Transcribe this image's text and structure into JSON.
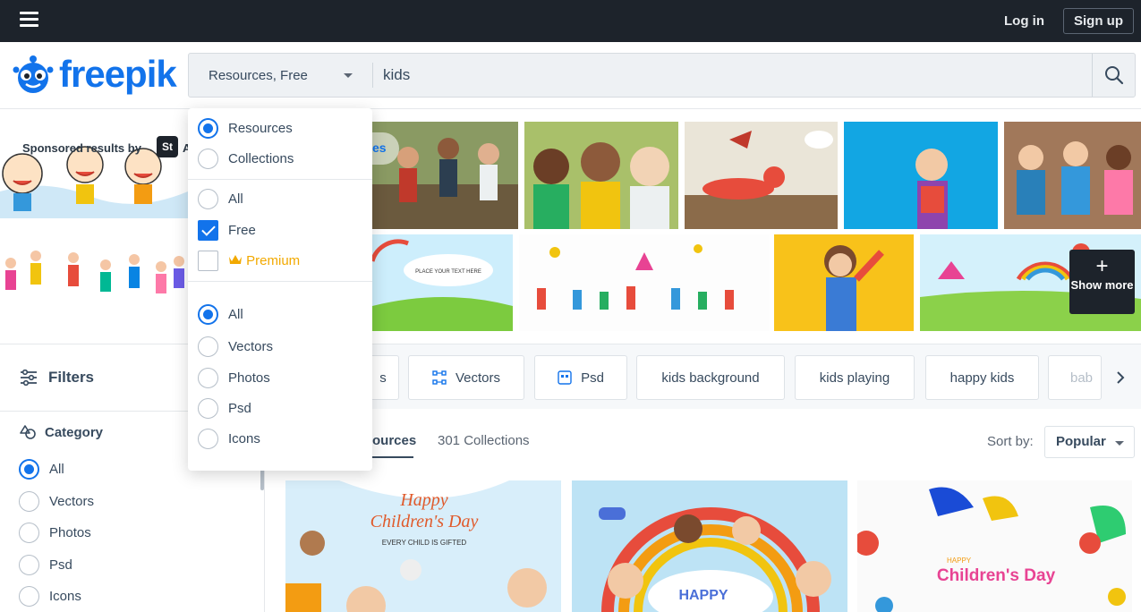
{
  "topbar": {
    "login": "Log in",
    "signup": "Sign up"
  },
  "logo": {
    "text": "freepik"
  },
  "search": {
    "type_label": "Resources, Free",
    "query": "kids"
  },
  "sidebar": {
    "sponsored": "Sponsored results by",
    "st_badge": "St",
    "st_suffix": "A",
    "filters_label": "Filters",
    "category_label": "Category",
    "category_options": [
      "All",
      "Vectors",
      "Photos",
      "Psd",
      "Icons"
    ]
  },
  "grid": {
    "show_more": "Show more",
    "overlay_text": "es"
  },
  "tags": [
    "s",
    "Vectors",
    "Psd",
    "kids background",
    "kids playing",
    "happy kids",
    "bab"
  ],
  "results": {
    "tab_resources": "ources",
    "tab_collections": "301 Collections",
    "sort_label": "Sort by:",
    "sort_value": "Popular"
  },
  "dropdown": {
    "group1": [
      "Resources",
      "Collections"
    ],
    "group2": [
      "All",
      "Free",
      "Premium"
    ],
    "group3": [
      "All",
      "Vectors",
      "Photos",
      "Psd",
      "Icons"
    ]
  },
  "cards": {
    "card1_title_line1": "Happy",
    "card1_title_line2": "Children's Day",
    "card1_subtitle": "EVERY CHILD IS GIFTED",
    "card2_title": "HAPPY",
    "card3_title_top": "HAPPY",
    "card3_title": "Children's Day",
    "banner_title": "PLACE YOUR TEXT HERE"
  },
  "colors": {
    "brand": "#1273eb",
    "dark": "#1d232b",
    "premium": "#f2a900"
  }
}
